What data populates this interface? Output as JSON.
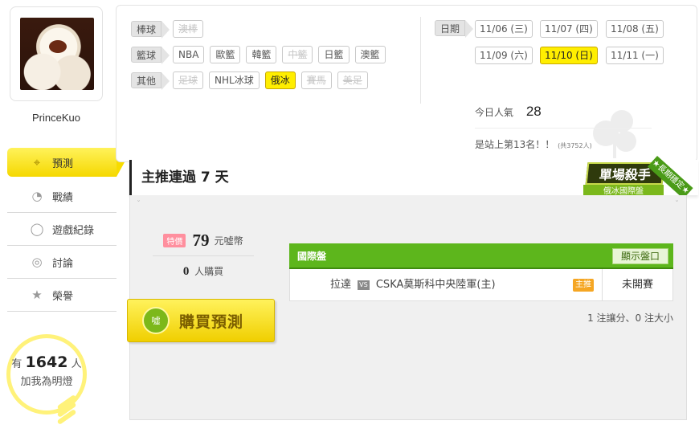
{
  "profile": {
    "username": "PrinceKuo"
  },
  "nav": [
    {
      "key": "predict",
      "label": "預測",
      "icon": "target-icon",
      "active": true
    },
    {
      "key": "record",
      "label": "戰績",
      "icon": "chart-icon",
      "active": false
    },
    {
      "key": "history",
      "label": "遊戲紀錄",
      "icon": "circle-icon",
      "active": false
    },
    {
      "key": "discuss",
      "label": "討論",
      "icon": "chat-search-icon",
      "active": false
    },
    {
      "key": "honor",
      "label": "榮譽",
      "icon": "medal-icon",
      "active": false
    }
  ],
  "fans": {
    "prefix": "有",
    "count": "1642",
    "unit": "人",
    "line2": "加我為明燈"
  },
  "filters": [
    {
      "category": "棒球",
      "chips": [
        {
          "label": "澳棒",
          "state": "disabled"
        }
      ]
    },
    {
      "category": "籃球",
      "chips": [
        {
          "label": "NBA",
          "state": "normal"
        },
        {
          "label": "歐籃",
          "state": "normal"
        },
        {
          "label": "韓籃",
          "state": "normal"
        },
        {
          "label": "中籃",
          "state": "disabled"
        },
        {
          "label": "日籃",
          "state": "normal"
        },
        {
          "label": "澳籃",
          "state": "normal"
        }
      ]
    },
    {
      "category": "其他",
      "chips": [
        {
          "label": "足球",
          "state": "disabled"
        },
        {
          "label": "NHL冰球",
          "state": "normal"
        },
        {
          "label": "俄冰",
          "state": "active"
        },
        {
          "label": "賽馬",
          "state": "disabled"
        },
        {
          "label": "美足",
          "state": "disabled"
        }
      ]
    }
  ],
  "dates": {
    "label": "日期",
    "items": [
      {
        "label": "11/06 (三)",
        "active": false
      },
      {
        "label": "11/07 (四)",
        "active": false
      },
      {
        "label": "11/08 (五)",
        "active": false
      },
      {
        "label": "11/09 (六)",
        "active": false
      },
      {
        "label": "11/10 (日)",
        "active": true
      },
      {
        "label": "11/11 (一)",
        "active": false
      }
    ]
  },
  "stats": {
    "popularity_label": "今日人氣",
    "popularity_value": "28",
    "rank_text": "是站上第13名！！",
    "rank_total": "(共3752人)"
  },
  "headline": "主推連過 7 天",
  "badge": {
    "main": "單場殺手",
    "sub": "俄冰國際盤",
    "ribbon": "★長期穩定★"
  },
  "offer": {
    "special_label": "特價",
    "price": "79",
    "currency": "元噓幣",
    "buyers_count": "0",
    "buyers_label": "人購買",
    "buy_icon_text": "噓",
    "buy_button": "購買預測"
  },
  "market": {
    "title": "國際盤",
    "show_odds_button": "顯示盤口",
    "games": [
      {
        "away": "拉達",
        "vs": "VS",
        "home": "CSKA莫斯科中央陸軍(主)",
        "pick": "主推",
        "status": "未開賽"
      }
    ],
    "summary": "1 注讓分、0 注大小"
  }
}
